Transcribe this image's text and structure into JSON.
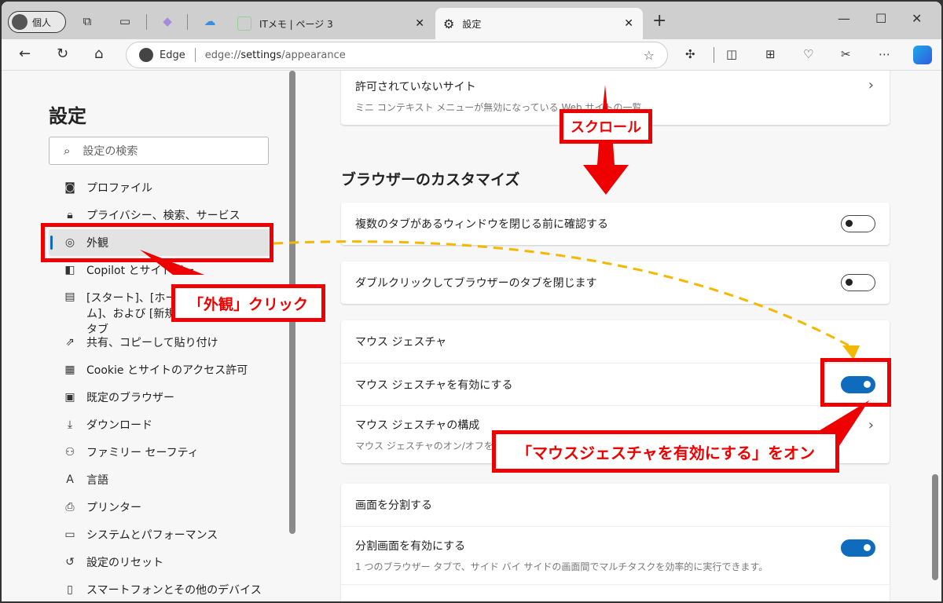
{
  "browser": {
    "profile_label": "個人",
    "tabs": [
      {
        "label": "ITメモ | ページ 3",
        "active": false
      },
      {
        "label": "設定",
        "active": true
      }
    ],
    "address": {
      "brand": "Edge",
      "url_prefix": "edge://",
      "url_bold": "settings",
      "url_suffix": "/appearance"
    },
    "toolbar_icons": [
      "extensions-icon",
      "split-screen-icon",
      "collections-icon",
      "browser-essentials-icon",
      "screenshot-icon",
      "more-icon",
      "copilot-icon"
    ]
  },
  "sidebar": {
    "title": "設定",
    "search_placeholder": "設定の検索",
    "items": [
      {
        "label": "プロファイル",
        "icon": "profile-icon"
      },
      {
        "label": "プライバシー、検索、サービス",
        "icon": "lock-icon"
      },
      {
        "label": "外観",
        "icon": "palette-icon",
        "active": true
      },
      {
        "label": "Copilot とサイドバー",
        "icon": "sidebar-icon"
      },
      {
        "label": "[スタート]、[ホーム]、および [新規] タブ",
        "icon": "start-icon"
      },
      {
        "label": "共有、コピーして貼り付け",
        "icon": "share-icon"
      },
      {
        "label": "Cookie とサイトのアクセス許可",
        "icon": "cookie-icon"
      },
      {
        "label": "既定のブラウザー",
        "icon": "default-browser-icon"
      },
      {
        "label": "ダウンロード",
        "icon": "download-icon"
      },
      {
        "label": "ファミリー セーフティ",
        "icon": "family-icon"
      },
      {
        "label": "言語",
        "icon": "language-icon"
      },
      {
        "label": "プリンター",
        "icon": "printer-icon"
      },
      {
        "label": "システムとパフォーマンス",
        "icon": "laptop-icon"
      },
      {
        "label": "設定のリセット",
        "icon": "reset-icon"
      },
      {
        "label": "スマートフォンとその他のデバイス",
        "icon": "phone-icon"
      }
    ]
  },
  "main": {
    "blocked_sites": {
      "title": "許可されていないサイト",
      "desc": "ミニ コンテキスト メニューが無効になっている Web サイトの一覧"
    },
    "section_title": "ブラウザーのカスタマイズ",
    "confirm_close": {
      "label": "複数のタブがあるウィンドウを閉じる前に確認する",
      "on": false
    },
    "dblclick_close": {
      "label": "ダブルクリックしてブラウザーのタブを閉じます",
      "on": false
    },
    "mouse_gesture": {
      "header": "マウス ジェスチャ",
      "enable_label": "マウス ジェスチャを有効にする",
      "enable_on": true,
      "config_title": "マウス ジェスチャの構成",
      "config_desc": "マウス ジェスチャのオン/オフを切り替えます"
    },
    "split_screen": {
      "header": "画面を分割する",
      "enable_label": "分割画面を有効にする",
      "enable_on": true,
      "desc": "1 つのブラウザー タブで、サイド バイ サイドの画面間でマルチタスクを効率的に実行できます。"
    }
  },
  "annotations": {
    "scroll": "スクロール",
    "click_appearance": "「外観」クリック",
    "turn_on": "「マウスジェスチャを有効にする」をオン",
    "accent": "#e00000",
    "arrow_color": "#f5b800"
  }
}
